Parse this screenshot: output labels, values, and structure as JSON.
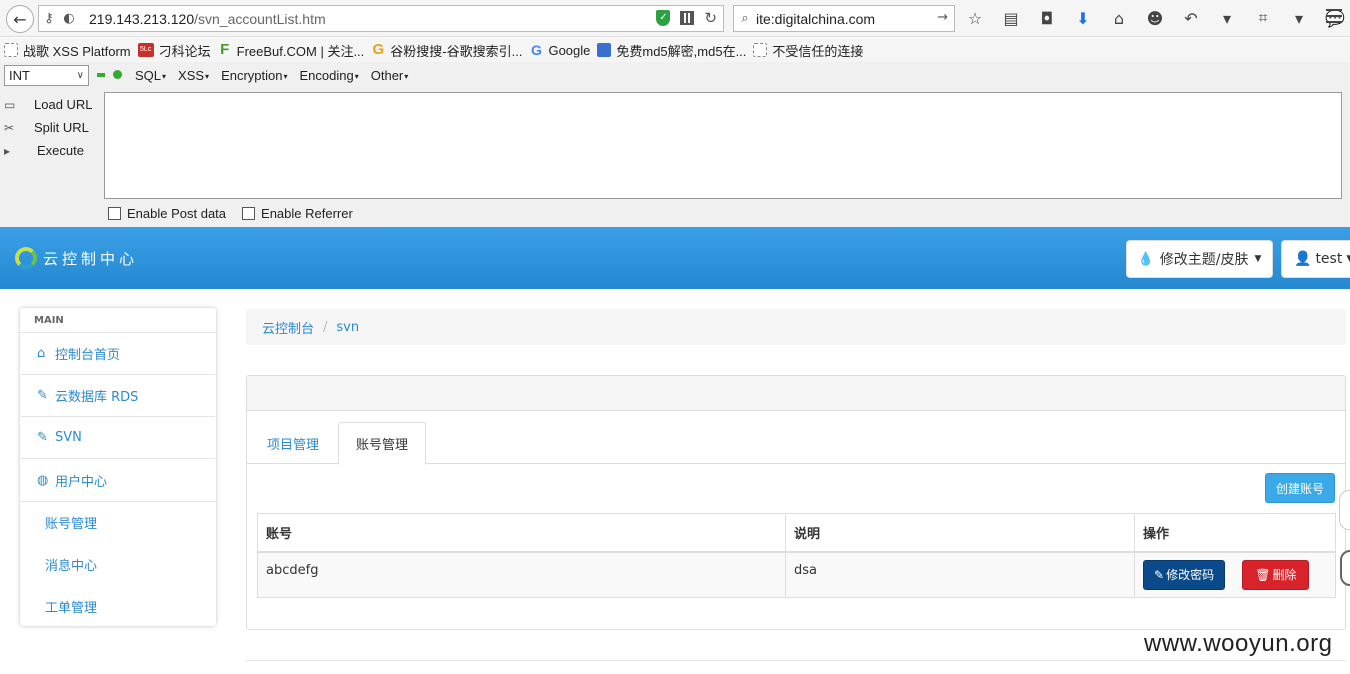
{
  "browser": {
    "url_host": "219.143.213.120",
    "url_path": "/svn_accountList.htm",
    "search_text": "ite:digitalchina.com",
    "bookmarks": [
      {
        "label": "战歌 XSS Platform",
        "icon": "blank"
      },
      {
        "label": "刁科论坛",
        "icon": "red",
        "glyph": "5Lc"
      },
      {
        "label": "FreeBuf.COM | 关注...",
        "icon": "green",
        "glyph": "F"
      },
      {
        "label": "谷粉搜搜-谷歌搜索引...",
        "icon": "orange",
        "glyph": "G"
      },
      {
        "label": "Google",
        "icon": "g",
        "glyph": "G"
      },
      {
        "label": "免费md5解密,md5在...",
        "icon": "md5",
        "glyph": ""
      },
      {
        "label": "不受信任的连接",
        "icon": "blank"
      }
    ]
  },
  "hackbar": {
    "select_value": "INT",
    "menus": [
      "SQL",
      "XSS",
      "Encryption",
      "Encoding",
      "Other"
    ],
    "actions": {
      "load": "Load URL",
      "split": "Split URL",
      "execute": "Execute"
    },
    "textarea_value": "",
    "checks": {
      "post": "Enable Post data",
      "referrer": "Enable Referrer"
    }
  },
  "header": {
    "logo_text": "云控制中心",
    "theme_button": "修改主题/皮肤",
    "user_button": "test"
  },
  "sidebar": {
    "section": "MAIN",
    "items": [
      {
        "label": "控制台首页",
        "icon": "home-icon"
      },
      {
        "label": "云数据库 RDS",
        "icon": "edit-icon"
      },
      {
        "label": "SVN",
        "icon": "edit-icon"
      },
      {
        "label": "用户中心",
        "icon": "globe-icon"
      }
    ],
    "subitems": [
      "账号管理",
      "消息中心",
      "工单管理"
    ]
  },
  "breadcrumb": [
    "云控制台",
    "svn"
  ],
  "tabs": {
    "projects": "项目管理",
    "accounts": "账号管理"
  },
  "create_button": "创建账号",
  "table": {
    "headers": [
      "账号",
      "说明",
      "操作"
    ],
    "rows": [
      {
        "account": "abcdefg",
        "desc": "dsa",
        "edit": "修改密码",
        "delete": "删除"
      }
    ]
  },
  "watermark": "www.wooyun.org",
  "colors": {
    "accent": "#2b8ad0",
    "header": "#2588d0",
    "edit": "#0b4a8a",
    "delete": "#d9232a",
    "create": "#3ba9e8"
  }
}
